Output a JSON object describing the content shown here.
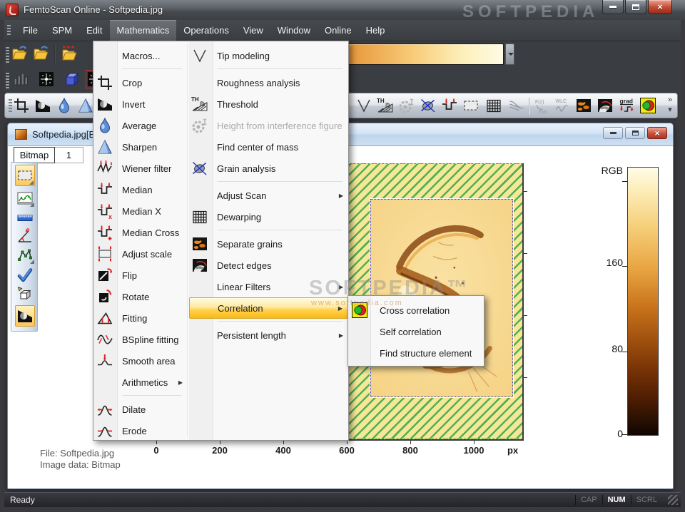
{
  "window": {
    "title": "FemtoScan Online - Softpedia.jpg"
  },
  "watermark": {
    "top": "SOFTPEDIA",
    "middle": "SOFTPEDIA™",
    "url": "www.softpedia.com"
  },
  "menubar": {
    "items": [
      {
        "label": "File"
      },
      {
        "label": "SPM"
      },
      {
        "label": "Edit"
      },
      {
        "label": "Mathematics",
        "active": true
      },
      {
        "label": "Operations"
      },
      {
        "label": "View"
      },
      {
        "label": "Window"
      },
      {
        "label": "Online"
      },
      {
        "label": "Help"
      }
    ]
  },
  "toolbars": {
    "row1_icons": [
      "open-folder",
      "open-folder-alt",
      "import-folder",
      "palette-gradient-bar"
    ],
    "row2_icons": [
      "histogram",
      "fft-filter",
      "surface-3d"
    ],
    "row3_icons": [
      "crop",
      "invert",
      "average",
      "sharpen",
      "tip-modeling",
      "threshold",
      "height-from-interference",
      "grain-analysis",
      "median",
      "median-select",
      "dewarping",
      "force-curves",
      "f-z",
      "wlc",
      "separate-grains",
      "detect-edges",
      "gradient",
      "correlation"
    ]
  },
  "math_menu": {
    "left": [
      {
        "label": "Macros..."
      },
      {
        "label": "Crop"
      },
      {
        "label": "Invert"
      },
      {
        "label": "Average"
      },
      {
        "label": "Sharpen"
      },
      {
        "label": "Wiener filter"
      },
      {
        "label": "Median"
      },
      {
        "label": "Median X"
      },
      {
        "label": "Median Cross"
      },
      {
        "label": "Adjust scale"
      },
      {
        "label": "Flip"
      },
      {
        "label": "Rotate"
      },
      {
        "label": "Fitting"
      },
      {
        "label": "BSpline fitting"
      },
      {
        "label": "Smooth area"
      },
      {
        "label": "Arithmetics"
      },
      {
        "label": "Dilate"
      },
      {
        "label": "Erode"
      }
    ],
    "right": [
      {
        "label": "Tip modeling"
      },
      {
        "label": "Roughness analysis"
      },
      {
        "label": "Threshold"
      },
      {
        "label": "Height from interference figure",
        "disabled": true
      },
      {
        "label": "Find center of mass"
      },
      {
        "label": "Grain analysis"
      },
      {
        "label": "Adjust Scan"
      },
      {
        "label": "Dewarping"
      },
      {
        "label": "Separate grains"
      },
      {
        "label": "Detect edges"
      },
      {
        "label": "Linear Filters"
      },
      {
        "label": "Correlation",
        "highlighted": true
      },
      {
        "label": "Persistent length"
      }
    ]
  },
  "submenu": {
    "items": [
      {
        "label": "Cross correlation"
      },
      {
        "label": "Self correlation"
      },
      {
        "label": "Find structure element"
      }
    ]
  },
  "doc": {
    "title": "Softpedia.jpg[Bi",
    "tabs": [
      {
        "label": "Bitmap",
        "active": true
      },
      {
        "label": "1"
      }
    ],
    "xaxis": {
      "ticks": [
        "0",
        "200",
        "400",
        "600",
        "800",
        "1000"
      ],
      "unit": "px"
    },
    "colorbar": {
      "title": "RGB",
      "tick_labels": [
        "160",
        "80",
        "0"
      ]
    },
    "info_lines": [
      "File: Softpedia.jpg",
      "Image data: Bitmap"
    ]
  },
  "statusbar": {
    "message": "Ready",
    "indicators": [
      {
        "label": "CAP",
        "active": false
      },
      {
        "label": "NUM",
        "active": true
      },
      {
        "label": "SCRL",
        "active": false
      }
    ]
  },
  "colors": {
    "menu_highlight": "#fcb814",
    "hatch_bg": "#f6e794",
    "hatch_line": "#3aa04a",
    "palette_dark": "#120300",
    "palette_light": "#fffbe4"
  }
}
